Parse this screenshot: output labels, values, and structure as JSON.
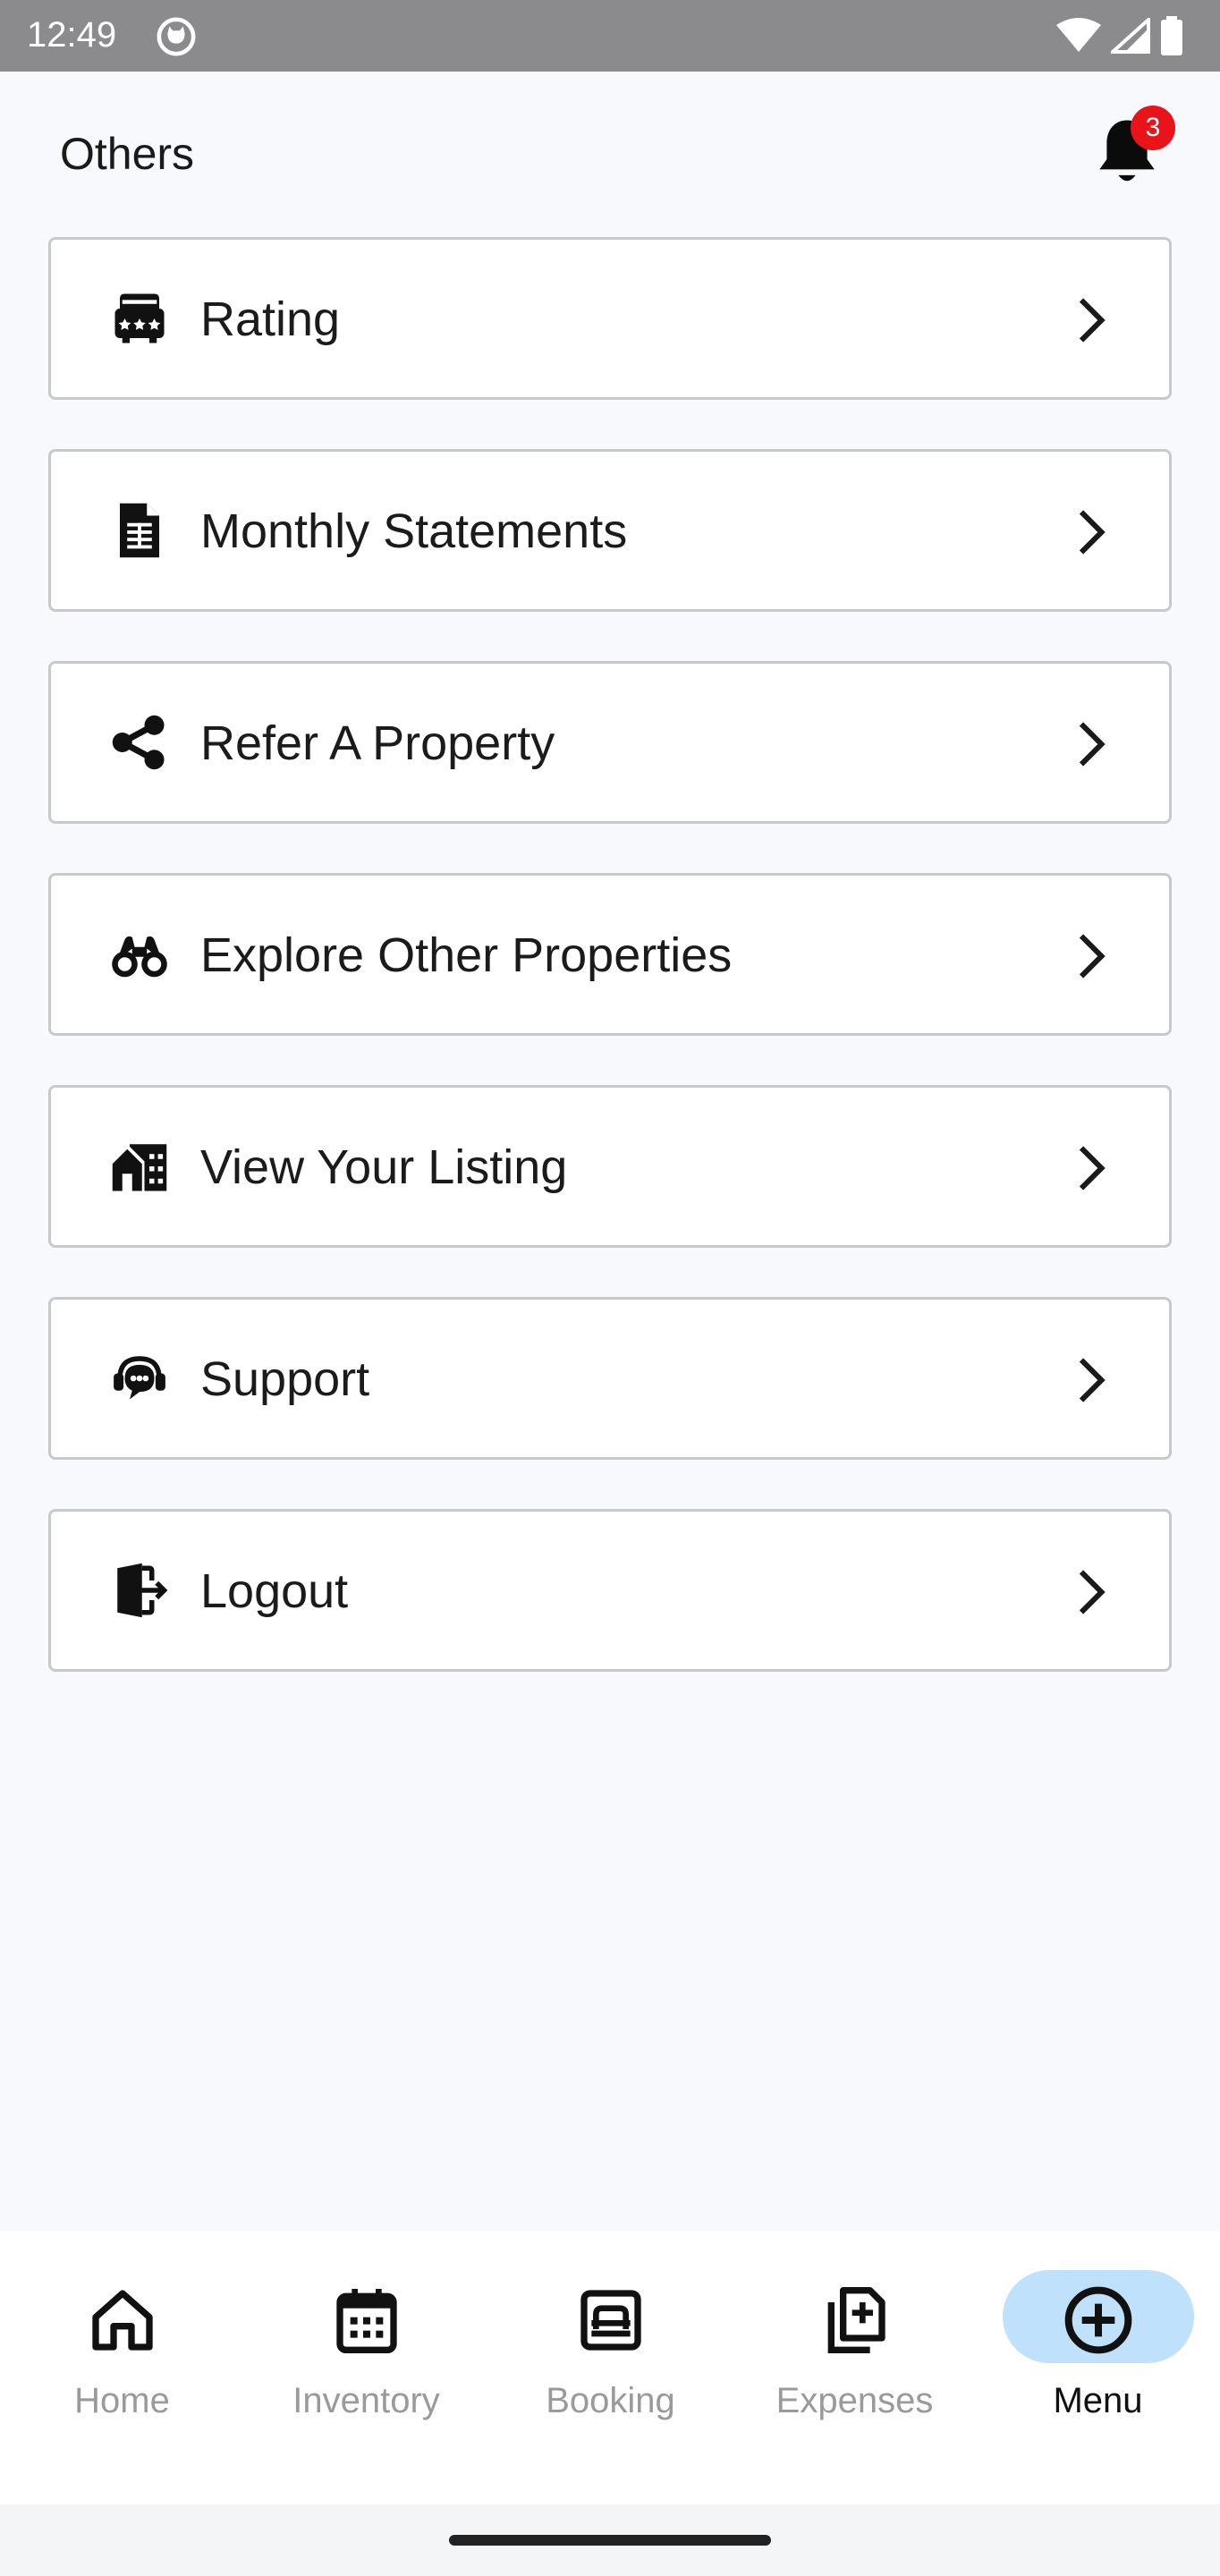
{
  "status_bar": {
    "time": "12:49"
  },
  "header": {
    "title": "Others",
    "notification_count": "3"
  },
  "menu": {
    "items": [
      {
        "label": "Rating",
        "icon": "rating-icon"
      },
      {
        "label": "Monthly Statements",
        "icon": "document-icon"
      },
      {
        "label": "Refer A Property",
        "icon": "share-icon"
      },
      {
        "label": "Explore Other Properties",
        "icon": "binoculars-icon"
      },
      {
        "label": "View Your Listing",
        "icon": "house-listing-icon"
      },
      {
        "label": "Support",
        "icon": "support-chat-icon"
      },
      {
        "label": "Logout",
        "icon": "logout-icon"
      }
    ]
  },
  "bottom_nav": {
    "items": [
      {
        "label": "Home",
        "icon": "home-icon",
        "active": false
      },
      {
        "label": "Inventory",
        "icon": "calendar-icon",
        "active": false
      },
      {
        "label": "Booking",
        "icon": "booking-icon",
        "active": false
      },
      {
        "label": "Expenses",
        "icon": "expenses-icon",
        "active": false
      },
      {
        "label": "Menu",
        "icon": "add-circle-icon",
        "active": true
      }
    ]
  },
  "colors": {
    "accent_pill": "#bfe1fb",
    "badge": "#e8141a",
    "status_bar": "#8b8b8d",
    "inactive_nav": "#9a9a9a"
  }
}
